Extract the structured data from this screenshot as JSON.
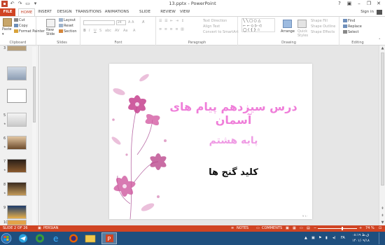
{
  "titlebar": {
    "title": "13.pptx - PowerPoint",
    "help": "?",
    "minimize": "–",
    "restore": "❐",
    "close": "✕"
  },
  "tabs": [
    "FILE",
    "HOME",
    "INSERT",
    "DESIGN",
    "TRANSITIONS",
    "ANIMATIONS",
    "SLIDE SHOW",
    "REVIEW",
    "VIEW"
  ],
  "active_tab": "HOME",
  "signin": "Sign in",
  "ribbon": {
    "clipboard": {
      "paste": "Paste",
      "cut": "Cut",
      "copy": "Copy",
      "format_painter": "Format Painter",
      "label": "Clipboard"
    },
    "slides": {
      "new_slide": "New",
      "new_slide2": "Slide",
      "layout": "Layout",
      "reset": "Reset",
      "section": "Section",
      "label": "Slides"
    },
    "font": {
      "size": "24",
      "label": "Font"
    },
    "paragraph": {
      "text_direction": "Text Direction",
      "align_text": "Align Text",
      "convert_smartart": "Convert to SmartArt",
      "label": "Paragraph"
    },
    "drawing": {
      "arrange": "Arrange",
      "quick_styles": "Quick",
      "quick_styles2": "Styles",
      "shape_fill": "Shape Fill",
      "shape_outline": "Shape Outline",
      "shape_effects": "Shape Effects",
      "label": "Drawing"
    },
    "editing": {
      "find": "Find",
      "replace": "Replace",
      "select": "Select",
      "label": "Editing"
    }
  },
  "slides_panel": {
    "numbers": [
      "5",
      "6",
      "7",
      "8",
      "9",
      "10"
    ],
    "first_number": "3"
  },
  "slide": {
    "title": "درس سیزدهم پیام های آسمان",
    "subtitle": "پایه هشتم",
    "key": "کلید گنج ها",
    "footer": "۲ ۱۰"
  },
  "status": {
    "slide_of": "SLIDE 2 OF 26",
    "language": "PERSIAN",
    "notes": "NOTES",
    "comments": "COMMENTS",
    "zoom": "74 %"
  },
  "taskbar": {
    "time": "۰۸:۱۹ ق.ظ",
    "date": "۱۴۰۱/۰۹/۱۸",
    "lang": "FA"
  },
  "colors": {
    "accent": "#d04423",
    "taskbar": "#1f4f7e",
    "title_pink": "#ef7ed9",
    "subtitle_pink": "#ef9be4"
  }
}
